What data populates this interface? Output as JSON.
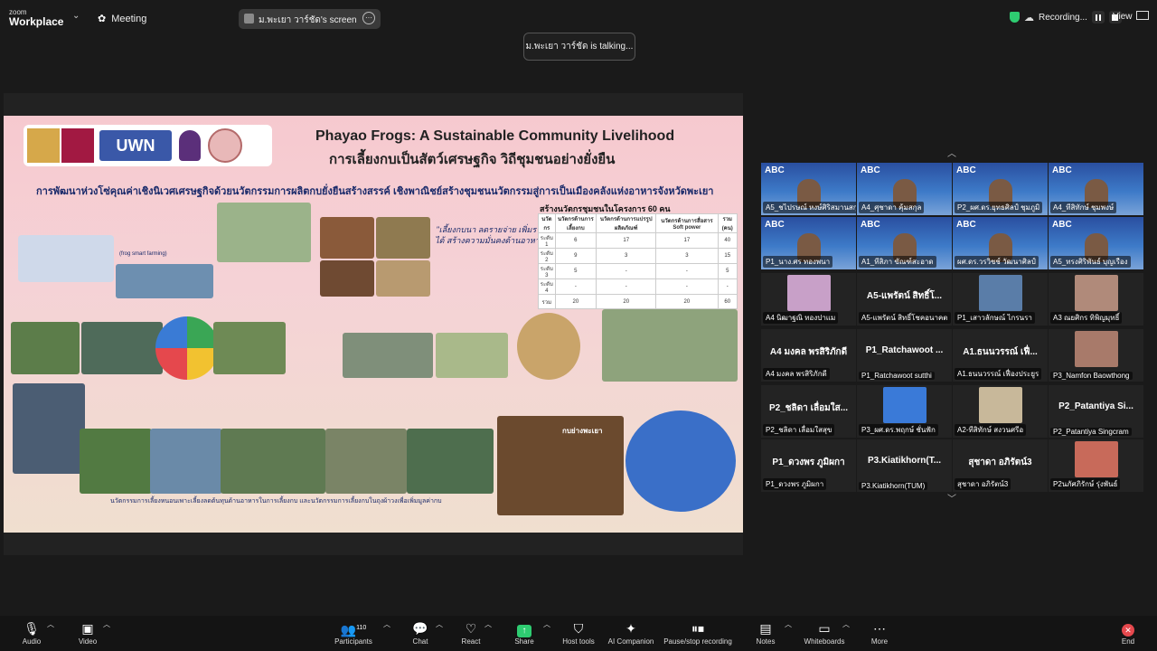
{
  "app": {
    "logo_line1": "zoom",
    "logo_line2": "Workplace",
    "meeting_label": "Meeting",
    "share_pill": "ม.พะเยา วาร์ชัด's screen",
    "talking": "ม.พะเยา วาร์ชัด is talking...",
    "recording_label": "Recording...",
    "view_label": "View",
    "accent_green": "#2ecc71",
    "end_red": "#e5484d"
  },
  "slide": {
    "logo_uwn": "UWN",
    "title_en": "Phayao Frogs: A Sustainable Community Livelihood",
    "title_th": "การเลี้ยงกบเป็นสัตว์เศรษฐกิจ วิถีชุมชนอย่างยั่งยืน",
    "subtitle": "การพัฒนาห่วงโซ่คุณค่าเชิงนิเวศเศรษฐกิจด้วยนวัตกรรมการผลิตกบยั่งยืนสร้างสรรค์ เชิงพาณิชย์สร้างชุมชนนวัตกรรมสู่การเป็นเมืองคลังแห่งอาหารจังหวัดพะเยา",
    "quote_frog": "\"เลี้ยงกบนา ลดรายจ่าย เพิ่มรายได้ สร้างความมั่นคงด้านอาหาร\"",
    "table_title": "สร้างนวัตกรชุมชนในโครงการ 60 คน",
    "table_headers": [
      "นวัตกร",
      "นวัตกรด้านการเลี้ยงกบ",
      "นวัตกรด้านการแปรรูปผลิตภัณฑ์",
      "นวัตกรด้านการสื่อสาร Soft power",
      "รวม (คน)"
    ],
    "table_rows": [
      [
        "ระดับ 1",
        "6",
        "17",
        "17",
        "40"
      ],
      [
        "ระดับ 2",
        "9",
        "3",
        "3",
        "15"
      ],
      [
        "ระดับ 3",
        "5",
        "-",
        "-",
        "5"
      ],
      [
        "ระดับ 4",
        "-",
        "-",
        "-",
        "-"
      ],
      [
        "รวม",
        "20",
        "20",
        "20",
        "60"
      ]
    ],
    "bottom_caption": "นวัตกรรมการเลี้ยงหนอนเพาะเลี้ยงลดต้นทุนด้านอาหารในการเลี้ยงกบ และนวัตกรรมการเลี้ยงกบในถุงผ้าวงเพื่อเพิ่มมูลค่ากบ",
    "frog_farming": "(frog smart farming)",
    "frog_sign": "กบย่างพะเยา"
  },
  "participants": [
    {
      "name": "A5_ชไปรษณ์ หงษ์ศิริสมานสกุล",
      "type": "video"
    },
    {
      "name": "A4_ศุชาดา คุ้มสกุล",
      "type": "video"
    },
    {
      "name": "P2_ผศ.ดร.ยุทธศิลป์ ชุมภูมิ",
      "type": "video"
    },
    {
      "name": "A4_ทีสิทักษ์ ชุมพงษ์",
      "type": "video"
    },
    {
      "name": "P1_นาง.ศร ทองพนา",
      "type": "video"
    },
    {
      "name": "A1_ทีสิภา ขัณฑ์สะอาด",
      "type": "video"
    },
    {
      "name": "ผศ.ดร.วรวิชช์ วัฒนาศิลป์",
      "type": "video"
    },
    {
      "name": "A5_ทรงศิริพันธ์ บุญเรือง",
      "type": "video"
    },
    {
      "name": "A4 นิฒาฐณิ ทองปาแม",
      "big": "",
      "type": "photo"
    },
    {
      "name": "A5-แพรัตน์ สิทธิ์โชคอนาคต",
      "big": "A5-แพรัตน์ สิทธิ์โ...",
      "type": "text"
    },
    {
      "name": "P1_เสาวลักษณ์ ไกรนรา",
      "big": "",
      "type": "photo"
    },
    {
      "name": "A3 ณยศิกร ทิพิญมุทธิ์",
      "big": "",
      "type": "photo"
    },
    {
      "name": "A4 มงคล พรสิริภักดี",
      "big": "A4 มงคล พรสิริภักดี",
      "type": "text"
    },
    {
      "name": "P1_Ratchawoot sutthi",
      "big": "P1_Ratchawoot ...",
      "type": "text"
    },
    {
      "name": "A1.ธนนวรรณ์ เฟื่องประยูร",
      "big": "A1.ธนนวรรณ์ เฟื่...",
      "type": "text"
    },
    {
      "name": "P3_Namfon Baowthong",
      "big": "",
      "type": "photo"
    },
    {
      "name": "P2_ชลิดา เลื่อมใสสุข",
      "big": "P2_ชลิดา เลื่อมใส...",
      "type": "text"
    },
    {
      "name": "P3_ผศ.ดร.พฤกษ์ ชั่นฟัก",
      "big": "",
      "type": "photo"
    },
    {
      "name": "A2-ทีสิทักษ์ สงวนศรีอ",
      "big": "",
      "type": "photo"
    },
    {
      "name": "P2_Patantiya Singcram",
      "big": "P2_Patantiya Si...",
      "type": "text"
    },
    {
      "name": "P1_ดวงพร ภูมิผกา",
      "big": "P1_ดวงพร ภูมิผกา",
      "type": "text"
    },
    {
      "name": "P3.Kiatikhorn(TUM)",
      "big": "P3.Kiatikhorn(T...",
      "type": "text"
    },
    {
      "name": "สุชาดา อภิรัตน์3",
      "big": "สุชาดา อภิรัตน์3",
      "type": "text"
    },
    {
      "name": "P2นภัศภิรักษ์ รุ่งพันธ์",
      "big": "",
      "type": "photo"
    }
  ],
  "toolbar": {
    "audio": "Audio",
    "video": "Video",
    "participants": "Participants",
    "participants_count": "110",
    "chat": "Chat",
    "react": "React",
    "share": "Share",
    "host_tools": "Host tools",
    "ai_companion": "AI Companion",
    "pause_stop": "Pause/stop recording",
    "notes": "Notes",
    "whiteboards": "Whiteboards",
    "more": "More",
    "end": "End"
  }
}
